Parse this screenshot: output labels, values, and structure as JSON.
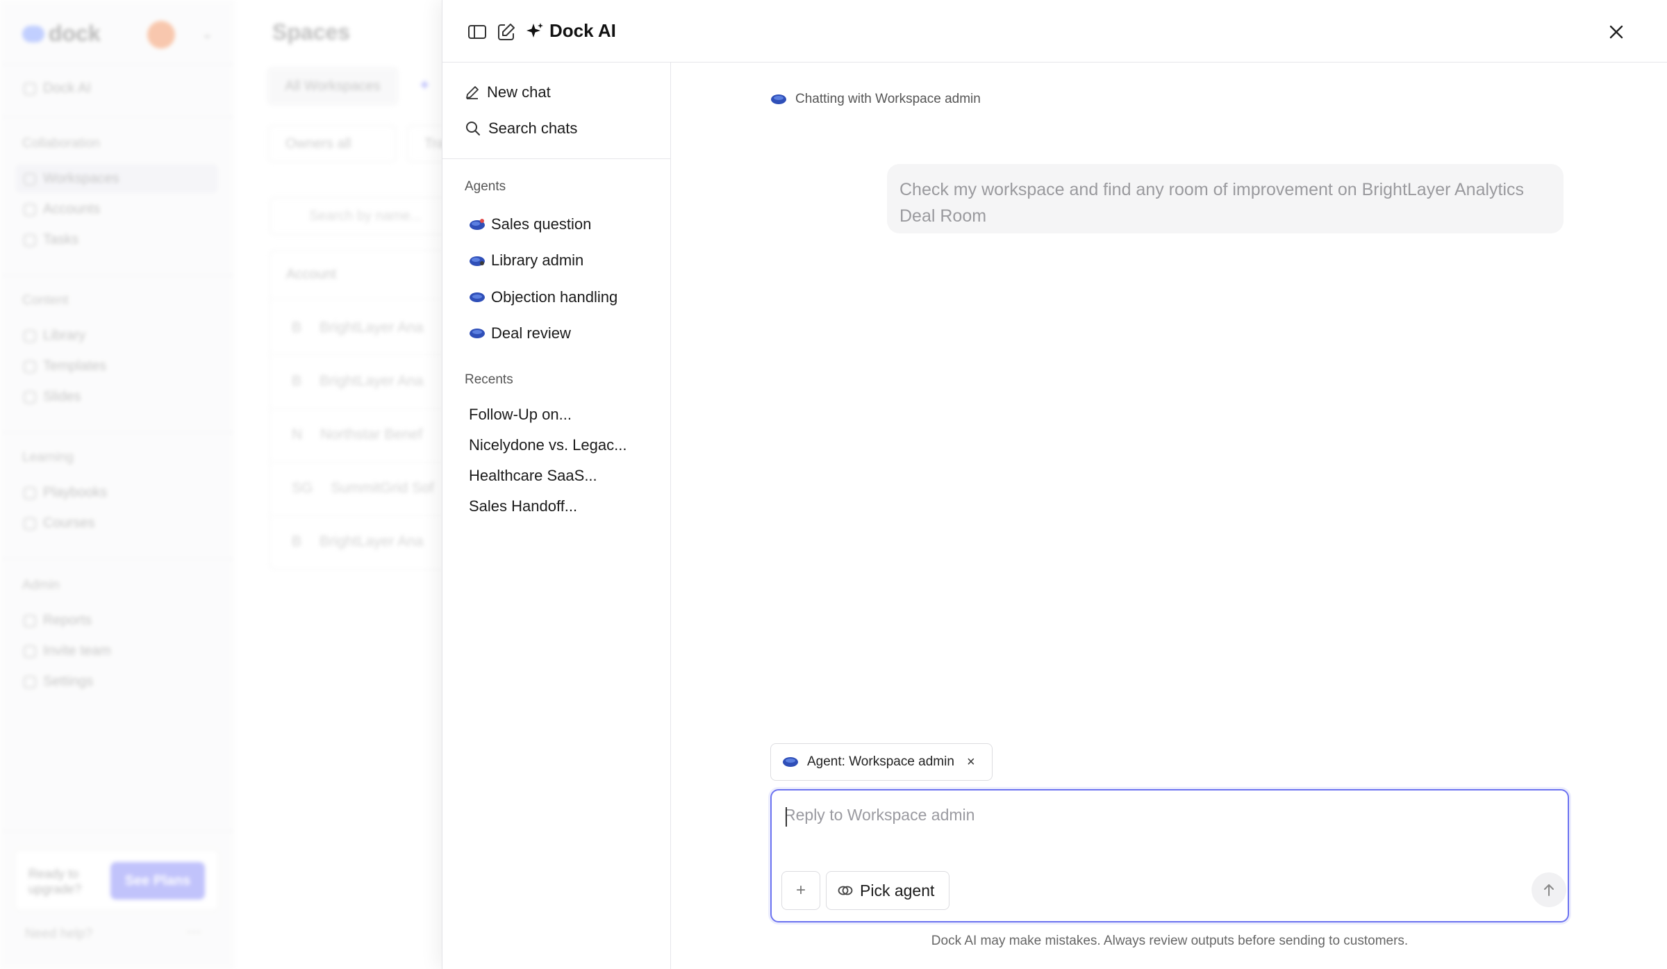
{
  "background": {
    "logo_text": "dock",
    "nav_dock_ai": "Dock AI",
    "sections": [
      {
        "heading": "Collaboration",
        "items": [
          "Workspaces",
          "Accounts",
          "Tasks"
        ]
      },
      {
        "heading": "Content",
        "items": [
          "Library",
          "Templates",
          "Slides"
        ]
      },
      {
        "heading": "Learning",
        "items": [
          "Playbooks",
          "Courses"
        ]
      },
      {
        "heading": "Admin",
        "items": [
          "Reports",
          "Invite team",
          "Settings"
        ]
      }
    ],
    "upgrade_text": "Ready to upgrade?",
    "upgrade_button": "See Plans",
    "help_text": "Need help?",
    "page_title": "Spaces",
    "tab_all": "All Workspaces",
    "filter_owners": "Owners all",
    "filter_second": "Tra",
    "search_placeholder": "Search by name...",
    "table_header": "Account",
    "rows": [
      {
        "initial": "B",
        "name": "BrightLayer Ana"
      },
      {
        "initial": "B",
        "name": "BrightLayer Ana"
      },
      {
        "initial": "N",
        "name": "Northstar Benef"
      },
      {
        "initial": "SG",
        "name": "SummitGrid Sof"
      },
      {
        "initial": "B",
        "name": "BrightLayer Ana"
      }
    ]
  },
  "panel": {
    "title": "Dock AI",
    "new_chat": "New chat",
    "search_chats": "Search chats",
    "agents_heading": "Agents",
    "agents": [
      "Sales question",
      "Library admin",
      "Objection handling",
      "Deal review"
    ],
    "recents_heading": "Recents",
    "recents": [
      "Follow-Up on...",
      "Nicelydone vs. Legac...",
      "Healthcare SaaS...",
      "Sales Handoff..."
    ],
    "chatting_with": "Chatting with Workspace admin",
    "user_message": "Check my workspace and find any room of improvement on BrightLayer Analytics Deal Room",
    "agent_chip": "Agent: Workspace admin",
    "input_placeholder": "Reply to Workspace admin",
    "input_value": "",
    "pick_agent": "Pick agent",
    "disclaimer": "Dock AI may make mistakes. Always review outputs before sending to customers."
  },
  "colors": {
    "accent": "#6b72f0",
    "agent_blob": "#2f4fb8"
  }
}
